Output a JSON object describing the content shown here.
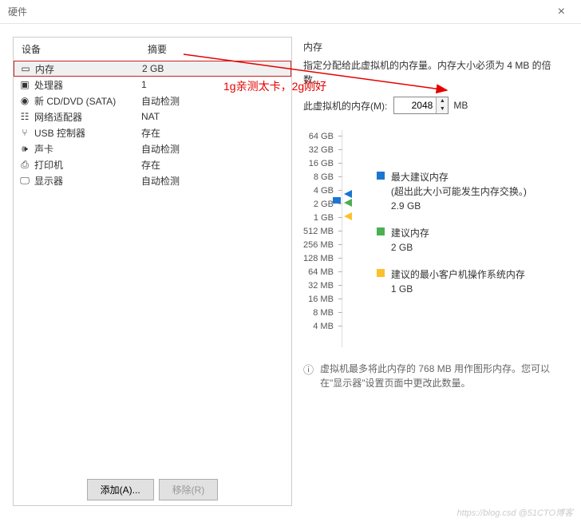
{
  "window": {
    "title": "硬件"
  },
  "list": {
    "header_device": "设备",
    "header_summary": "摘要",
    "rows": [
      {
        "icon": "memory",
        "device": "内存",
        "summary": "2 GB"
      },
      {
        "icon": "cpu",
        "device": "处理器",
        "summary": "1"
      },
      {
        "icon": "disc",
        "device": "新 CD/DVD (SATA)",
        "summary": "自动检测"
      },
      {
        "icon": "network",
        "device": "网络适配器",
        "summary": "NAT"
      },
      {
        "icon": "usb",
        "device": "USB 控制器",
        "summary": "存在"
      },
      {
        "icon": "sound",
        "device": "声卡",
        "summary": "自动检测"
      },
      {
        "icon": "printer",
        "device": "打印机",
        "summary": "存在"
      },
      {
        "icon": "display",
        "device": "显示器",
        "summary": "自动检测"
      }
    ]
  },
  "annotation": {
    "text": "1g亲测太卡，2g刚好"
  },
  "memory_panel": {
    "title": "内存",
    "desc": "指定分配给此虚拟机的内存量。内存大小必须为 4 MB 的倍数。",
    "input_label": "此虚拟机的内存(M):",
    "input_value": "2048",
    "unit": "MB"
  },
  "chart_data": {
    "type": "bar",
    "ticks": [
      "64 GB",
      "32 GB",
      "16 GB",
      "8 GB",
      "4 GB",
      "2 GB",
      "1 GB",
      "512 MB",
      "256 MB",
      "128 MB",
      "64 MB",
      "32 MB",
      "16 MB",
      "8 MB",
      "4 MB"
    ],
    "current_value": "2 GB",
    "markers": [
      {
        "color": "blue",
        "at": "2.9 GB",
        "label": "最大建议内存",
        "note": "(超出此大小可能发生内存交换。)"
      },
      {
        "color": "green",
        "at": "2 GB",
        "label": "建议内存"
      },
      {
        "color": "yellow",
        "at": "1 GB",
        "label": "建议的最小客户机操作系统内存"
      }
    ]
  },
  "legends": [
    {
      "color": "#1976d2",
      "title": "最大建议内存",
      "sub1": "(超出此大小可能发生内存交换。)",
      "sub2": "2.9 GB"
    },
    {
      "color": "#4caf50",
      "title": "建议内存",
      "sub1": "2 GB",
      "sub2": ""
    },
    {
      "color": "#fbc02d",
      "title": "建议的最小客户机操作系统内存",
      "sub1": "1 GB",
      "sub2": ""
    }
  ],
  "info_note": "虚拟机最多将此内存的 768 MB 用作图形内存。您可以在\"显示器\"设置页面中更改此数量。",
  "buttons": {
    "add": "添加(A)...",
    "remove": "移除(R)"
  },
  "watermark": "https://blog.csd @51CTO博客"
}
